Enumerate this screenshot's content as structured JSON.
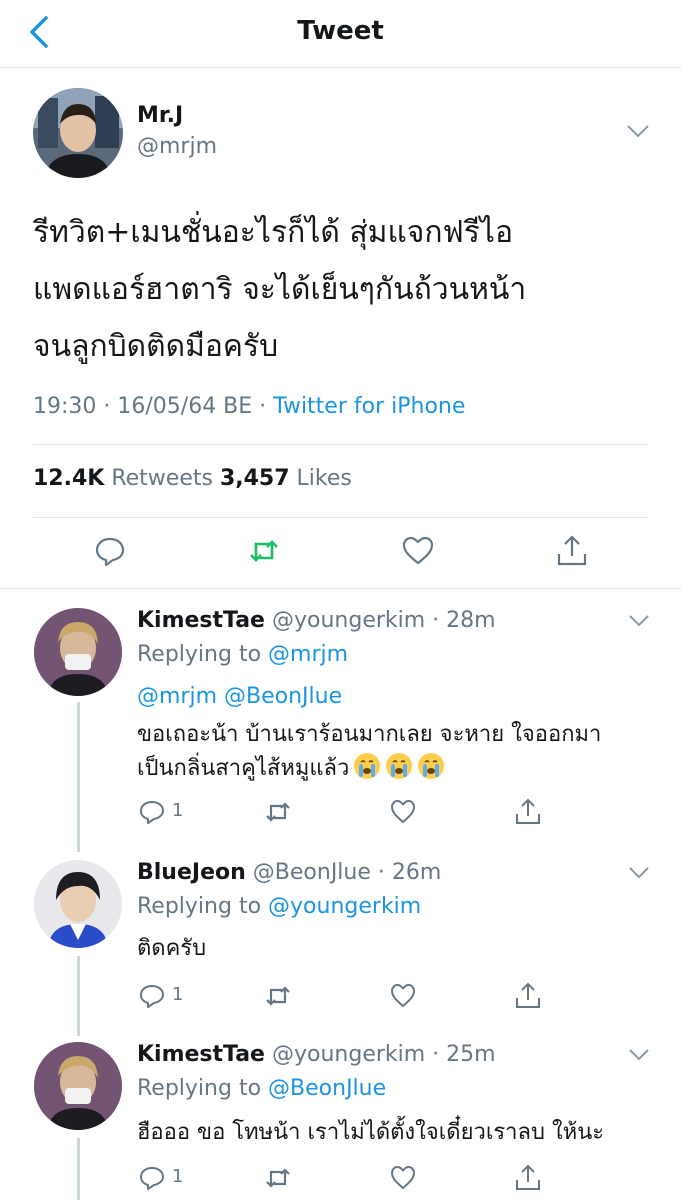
{
  "header": {
    "title": "Tweet"
  },
  "main_tweet": {
    "name": "Mr.J",
    "handle": "@mrjm",
    "text_lines": [
      "รีทวิต+เมนชั่นอะไรก็ได้ สุ่มแจกฟรีไอ",
      "แพดแอร์ฮาตาริ จะได้เย็นๆกันถ้วนหน้า",
      "จนลูกบิดติดมือครับ"
    ],
    "time": "19:30 · 16/05/64 BE · ",
    "source": "Twitter for iPhone",
    "retweets_count": "12.4K",
    "retweets_label": "Retweets",
    "likes_count": "3,457",
    "likes_label": "Likes"
  },
  "replies": [
    {
      "name": "KimestTae",
      "handle": "@youngerkim · 28m",
      "replying_prefix": "Replying to ",
      "replying_to": "@mrjm",
      "mentions": "@mrjm @BeonJlue",
      "line1": "ขอเถอะน้า บ้านเราร้อนมากเลย จะหาย ใจออกมา",
      "line2": "เป็นกลิ่นสาคูไส้หมูแล้ว",
      "reply_count": "1"
    },
    {
      "name": "BlueJeon",
      "handle": "@BeonJlue · 26m",
      "replying_prefix": "Replying to ",
      "replying_to": "@youngerkim",
      "line1": "ติดครับ",
      "reply_count": "1"
    },
    {
      "name": "KimestTae",
      "handle": "@youngerkim · 25m",
      "replying_prefix": "Replying to ",
      "replying_to": "@BeonJlue",
      "line1": "ฮือออ ขอ โทษน้า เราไม่ได้ตั้งใจเดี๋ยวเราลบ ให้นะ",
      "reply_count": "1"
    }
  ],
  "colors": {
    "accent": "#1b95e0",
    "retweet": "#17bf63",
    "muted": "#657786",
    "border": "#e1e8ed"
  },
  "icons": [
    "back-chevron-icon",
    "chevron-down-icon",
    "reply-icon",
    "retweet-icon",
    "like-icon",
    "share-icon",
    "crying-face-emoji"
  ]
}
